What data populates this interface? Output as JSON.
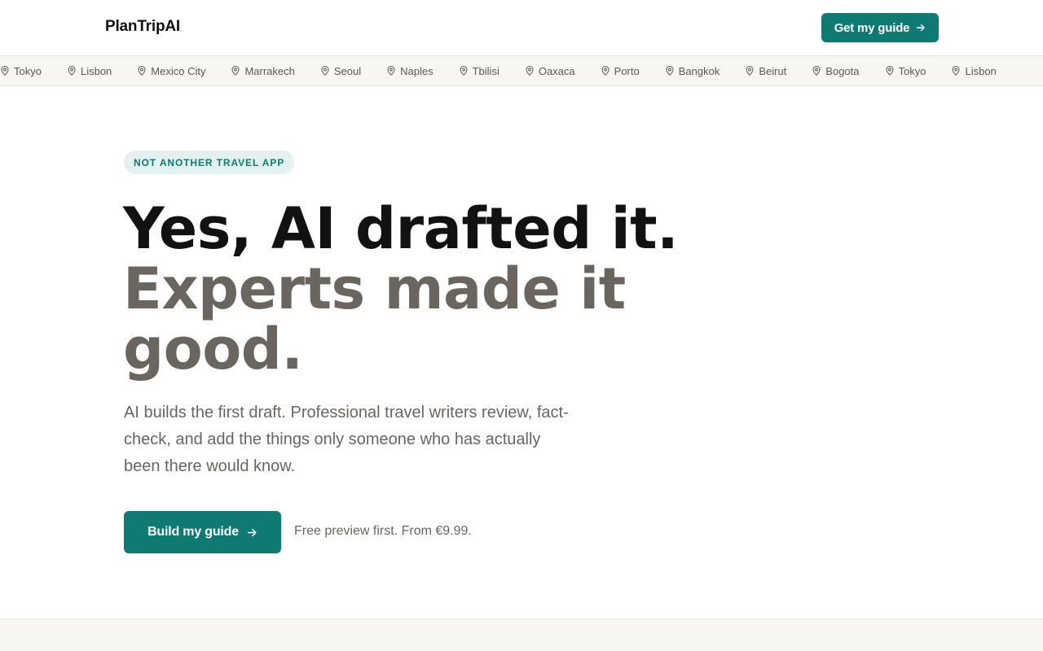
{
  "header": {
    "logo": "PlanTripAI",
    "cta_label": "Get my guide"
  },
  "ticker": {
    "cities": [
      "Tokyo",
      "Lisbon",
      "Mexico City",
      "Marrakech",
      "Seoul",
      "Naples",
      "Tbilisi",
      "Oaxaca",
      "Porto",
      "Bangkok",
      "Beirut",
      "Bogota",
      "Tokyo",
      "Lisbon"
    ]
  },
  "hero": {
    "badge": "NOT ANOTHER TRAVEL APP",
    "headline_line1": "Yes, AI drafted it.",
    "headline_line2": "Experts made it good.",
    "lede": "AI builds the first draft. Professional travel writers review, fact-check, and add the things only someone who has actually been there would know.",
    "cta_label": "Build my guide",
    "price_note": "Free preview first. From €9.99."
  },
  "icons": {
    "arrow": "arrow-right-icon",
    "pin": "map-pin-icon"
  },
  "colors": {
    "accent": "#0e7a72",
    "badge_bg": "#e3f2f0",
    "headline_dark": "#121212",
    "headline_muted": "#6b6560",
    "ticker_bg": "#f7f6f3"
  }
}
